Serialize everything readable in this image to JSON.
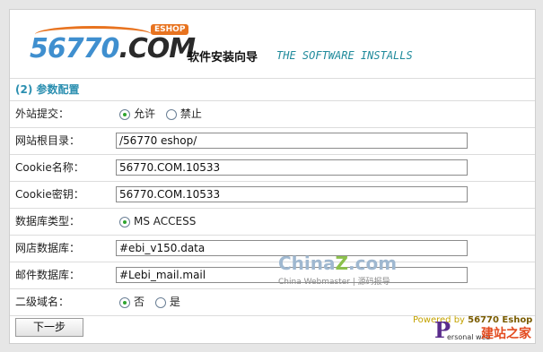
{
  "header": {
    "logo_num": "56770",
    "logo_com": ".COM",
    "logo_badge": "ESHOP",
    "title_cn": "软件安装向导",
    "title_en": "THE SOFTWARE INSTALLS"
  },
  "section_title": "(2) 参数配置",
  "rows": {
    "external_submit": {
      "label": "外站提交：",
      "options": [
        "允许",
        "禁止"
      ],
      "selected": "允许"
    },
    "site_root": {
      "label": "网站根目录：",
      "value": "/56770 eshop/"
    },
    "cookie_name": {
      "label": "Cookie名称：",
      "value": "56770.COM.10533"
    },
    "cookie_key": {
      "label": "Cookie密钥：",
      "value": "56770.COM.10533"
    },
    "db_type": {
      "label": "数据库类型：",
      "option": "MS ACCESS"
    },
    "shop_db": {
      "label": "网店数据库：",
      "value": "#ebi_v150.data"
    },
    "mail_db": {
      "label": "邮件数据库：",
      "value": "#Lebi_mail.mail"
    },
    "subdomain": {
      "label": "二级域名：",
      "options": [
        "否",
        "是"
      ],
      "selected": "否"
    }
  },
  "next_button": "下一步",
  "watermark": {
    "main_a": "China",
    "main_z": "Z",
    "main_b": ".com",
    "sub": "China Webmaster | 源码报导"
  },
  "powered": {
    "prefix": "Powered by ",
    "brand": "56770 Eshop"
  },
  "site_badge": {
    "letter": "P",
    "en": "ersonal web",
    "cn": "建站之家"
  },
  "colors": {
    "accent": "#2b8fb0",
    "radio_checked": "#2fa52f",
    "logo_blue": "#3f8fcf",
    "logo_orange": "#e8731f"
  }
}
